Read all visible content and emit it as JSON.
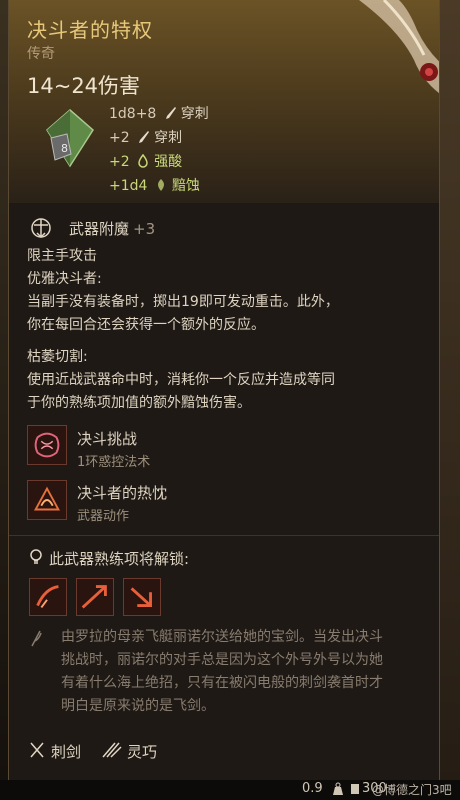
{
  "item": {
    "name": "决斗者的特权",
    "rarity": "传奇",
    "damage_total": "14~24伤害"
  },
  "damage_rows": [
    {
      "value": "1d8+8",
      "type": "穿刺",
      "type_icon": "sword-icon",
      "highlight": false
    },
    {
      "value": "+2",
      "type": "穿刺",
      "type_icon": "sword-icon",
      "highlight": false
    },
    {
      "value": "+2",
      "type": "强酸",
      "type_icon": "acid-icon",
      "highlight": true
    },
    {
      "value": "+1d4",
      "type": "黯蚀",
      "type_icon": "necrotic-icon",
      "highlight": true
    }
  ],
  "dice_label": "8",
  "enchantment": {
    "label": "武器附魔",
    "value": "+3"
  },
  "restriction": "限主手攻击",
  "passive1": {
    "title": "优雅决斗者:",
    "lines": [
      "当副手没有装备时，掷出19即可发动重击。此外，",
      "你在每回合还会获得一个额外的反应。"
    ]
  },
  "passive2": {
    "title": "枯萎切割:",
    "lines": [
      "使用近战武器命中时，消耗你一个反应并造成等同",
      "于你的熟练项加值的额外黯蚀伤害。"
    ]
  },
  "abilities": [
    {
      "name": "决斗挑战",
      "subtitle": "1环惑控法术",
      "icon": "duel-challenge-icon"
    },
    {
      "name": "决斗者的热忱",
      "subtitle": "武器动作",
      "icon": "duelist-zeal-icon"
    }
  ],
  "unlock": {
    "label": "此武器熟练项将解锁:",
    "icons": [
      "weapon-action-slash-icon",
      "weapon-action-lunge-icon",
      "weapon-action-pierce-icon"
    ]
  },
  "lore": [
    "由罗拉的母亲飞艇丽诺尔送给她的宝剑。当发出决斗",
    "挑战时，丽诺尔的对手总是因为这个外号外号以为她",
    "有着什么海上绝招，只有在被闪电般的刺剑袭首时才",
    "明白是原来说的是飞剑。"
  ],
  "properties": [
    {
      "label": "刺剑",
      "icon": "rapier-icon"
    },
    {
      "label": "灵巧",
      "icon": "finesse-icon"
    }
  ],
  "footer": {
    "weight": "0.9",
    "price": "300",
    "watermark": "@博德之门3吧"
  },
  "colors": {
    "title": "#e7c87a",
    "highlight": "#c8d87a",
    "lore": "#877c6e",
    "body_text": "#ddd3c0"
  }
}
